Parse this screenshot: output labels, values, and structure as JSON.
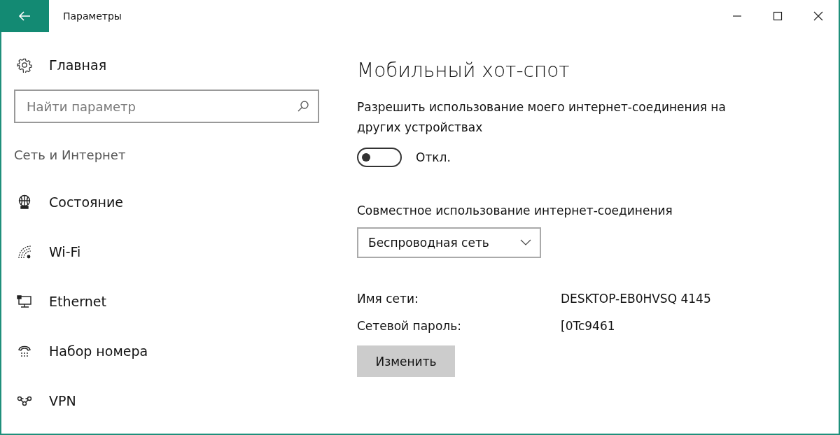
{
  "window": {
    "title": "Параметры"
  },
  "sidebar": {
    "home": "Главная",
    "search": {
      "placeholder": "Найти параметр"
    },
    "section": "Сеть и Интернет",
    "items": [
      {
        "label": "Состояние",
        "selected": false
      },
      {
        "label": "Wi-Fi",
        "selected": false
      },
      {
        "label": "Ethernet",
        "selected": false
      },
      {
        "label": "Набор номера",
        "selected": false
      },
      {
        "label": "VPN",
        "selected": false
      }
    ]
  },
  "content": {
    "title": "Мобильный хот-спот",
    "description": "Разрешить использование моего интернет-соединения на других устройствах",
    "toggle": {
      "on": false,
      "label": "Откл."
    },
    "sharing_label": "Совместное использование интернет-соединения",
    "dropdown": {
      "value": "Беспроводная сеть"
    },
    "details": [
      {
        "label": "Имя сети:",
        "value": "DESKTOP-EB0HVSQ 4145"
      },
      {
        "label": "Сетевой пароль:",
        "value": "[0Tc9461"
      }
    ],
    "button": "Изменить"
  }
}
